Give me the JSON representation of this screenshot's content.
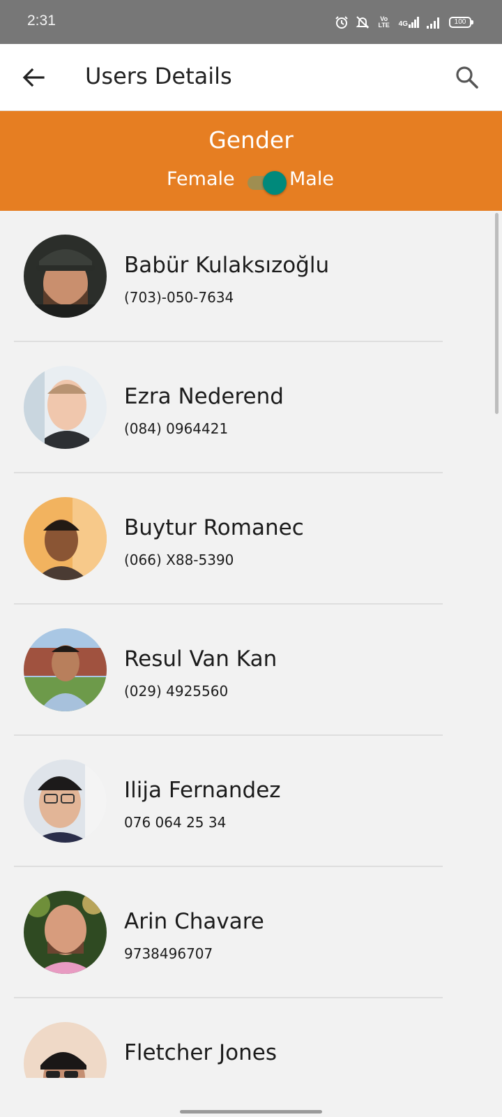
{
  "status_bar": {
    "time": "2:31",
    "volte_label": "Vo LTE",
    "network_label": "4G",
    "battery": "100",
    "icons": [
      "alarm-icon",
      "bell-off-icon",
      "volte-icon",
      "4g-signal-icon",
      "signal-icon",
      "battery-icon"
    ]
  },
  "app_bar": {
    "title": "Users Details",
    "back_icon": "arrow-left-icon",
    "search_icon": "search-icon"
  },
  "gender_filter": {
    "title": "Gender",
    "left_label": "Female",
    "right_label": "Male",
    "selected": "Male",
    "background_color": "#e67e22",
    "toggle_color": "#00897b"
  },
  "users": [
    {
      "name": "Babür Kulaksızoğlu",
      "phone": "(703)-050-7634"
    },
    {
      "name": "Ezra Nederend",
      "phone": "(084) 0964421"
    },
    {
      "name": "Buytur Romanec",
      "phone": "(066) X88-5390"
    },
    {
      "name": "Resul Van Kan",
      "phone": "(029) 4925560"
    },
    {
      "name": "Ilija Fernandez",
      "phone": "076 064 25 34"
    },
    {
      "name": "Arin Chavare",
      "phone": "9738496707"
    },
    {
      "name": "Fletcher Jones",
      "phone": ""
    }
  ]
}
